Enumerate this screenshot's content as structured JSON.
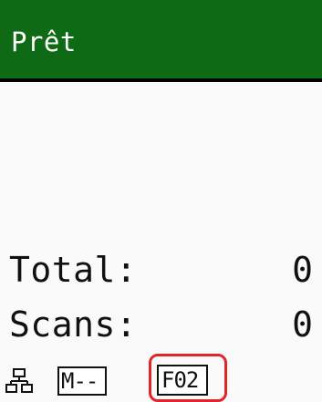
{
  "status": {
    "text": "Prêt",
    "background_color": "#0e6a14"
  },
  "counters": {
    "total_label": "Total:",
    "total_value": "0",
    "scans_label": "Scans:",
    "scans_value": "0"
  },
  "bottom_bar": {
    "network_icon": "network-icon",
    "mode_text": "M--",
    "format_text": "F02",
    "highlight_color": "#e1262b"
  }
}
